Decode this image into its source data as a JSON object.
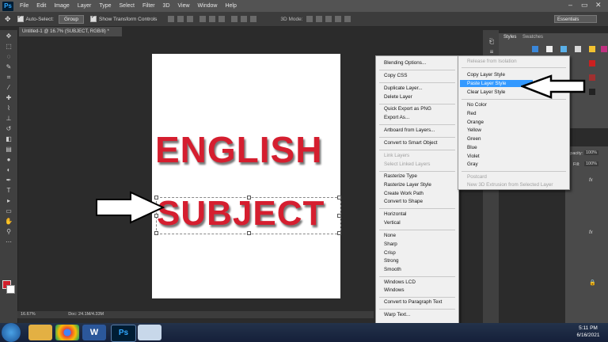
{
  "menubar": {
    "logo": "Ps",
    "items": [
      "File",
      "Edit",
      "Image",
      "Layer",
      "Type",
      "Select",
      "Filter",
      "3D",
      "View",
      "Window",
      "Help"
    ]
  },
  "options": {
    "auto_select": "Auto-Select:",
    "group": "Group",
    "show_transform": "Show Transform Controls",
    "mode_3d": "3D Mode:",
    "workspace": "Essentials"
  },
  "document": {
    "tab_title": "Untitled-1 @ 16.7% (SUBJECT, RGB/8) *",
    "line1": "ENGLISH",
    "line2": "SUBJECT",
    "zoom": "16.67%",
    "doc_size": "Doc: 24.1M/4.33M"
  },
  "panels": {
    "styles_tab": "Styles",
    "swatches_tab": "Swatches",
    "opacity_label": "Opacity:",
    "opacity_value": "100%",
    "fill_label": "Fill:",
    "fill_value": "100%",
    "fx": "fx"
  },
  "menu1": {
    "items": [
      {
        "label": "Blending Options...",
        "disabled": false
      },
      {
        "label": "Copy CSS",
        "disabled": false
      },
      {
        "label": "Duplicate Layer...",
        "disabled": false
      },
      {
        "label": "Delete Layer",
        "disabled": false
      },
      {
        "label": "Quick Export as PNG",
        "disabled": false
      },
      {
        "label": "Export As...",
        "disabled": false
      },
      {
        "label": "Artboard from Layers...",
        "disabled": false
      },
      {
        "label": "Convert to Smart Object",
        "disabled": false
      },
      {
        "label": "Link Layers",
        "disabled": true
      },
      {
        "label": "Select Linked Layers",
        "disabled": true
      },
      {
        "label": "Rasterize Type",
        "disabled": false
      },
      {
        "label": "Rasterize Layer Style",
        "disabled": false
      },
      {
        "label": "Create Work Path",
        "disabled": false
      },
      {
        "label": "Convert to Shape",
        "disabled": false
      },
      {
        "label": "Horizontal",
        "disabled": false
      },
      {
        "label": "Vertical",
        "disabled": false
      },
      {
        "label": "None",
        "disabled": false
      },
      {
        "label": "Sharp",
        "disabled": false
      },
      {
        "label": "Crisp",
        "disabled": false
      },
      {
        "label": "Strong",
        "disabled": false
      },
      {
        "label": "Smooth",
        "disabled": false
      },
      {
        "label": "Windows LCD",
        "disabled": false
      },
      {
        "label": "Windows",
        "disabled": false
      },
      {
        "label": "Convert to Paragraph Text",
        "disabled": false
      },
      {
        "label": "Warp Text...",
        "disabled": false
      }
    ]
  },
  "menu2": {
    "items": [
      {
        "label": "Release from Isolation",
        "disabled": true
      },
      {
        "label": "Copy Layer Style",
        "disabled": false
      },
      {
        "label": "Paste Layer Style",
        "disabled": false,
        "highlighted": true
      },
      {
        "label": "Clear Layer Style",
        "disabled": false
      },
      {
        "label": "No Color",
        "disabled": false
      },
      {
        "label": "Red",
        "disabled": false
      },
      {
        "label": "Orange",
        "disabled": false
      },
      {
        "label": "Yellow",
        "disabled": false
      },
      {
        "label": "Green",
        "disabled": false
      },
      {
        "label": "Blue",
        "disabled": false
      },
      {
        "label": "Violet",
        "disabled": false
      },
      {
        "label": "Gray",
        "disabled": false
      },
      {
        "label": "Postcard",
        "disabled": true
      },
      {
        "label": "New 3D Extrusion from Selected Layer",
        "disabled": true
      }
    ]
  },
  "clock": {
    "time": "5:11 PM",
    "date": "6/16/2021"
  },
  "colors": {
    "accent": "#3399ff",
    "text_red": "#d51e2f"
  }
}
